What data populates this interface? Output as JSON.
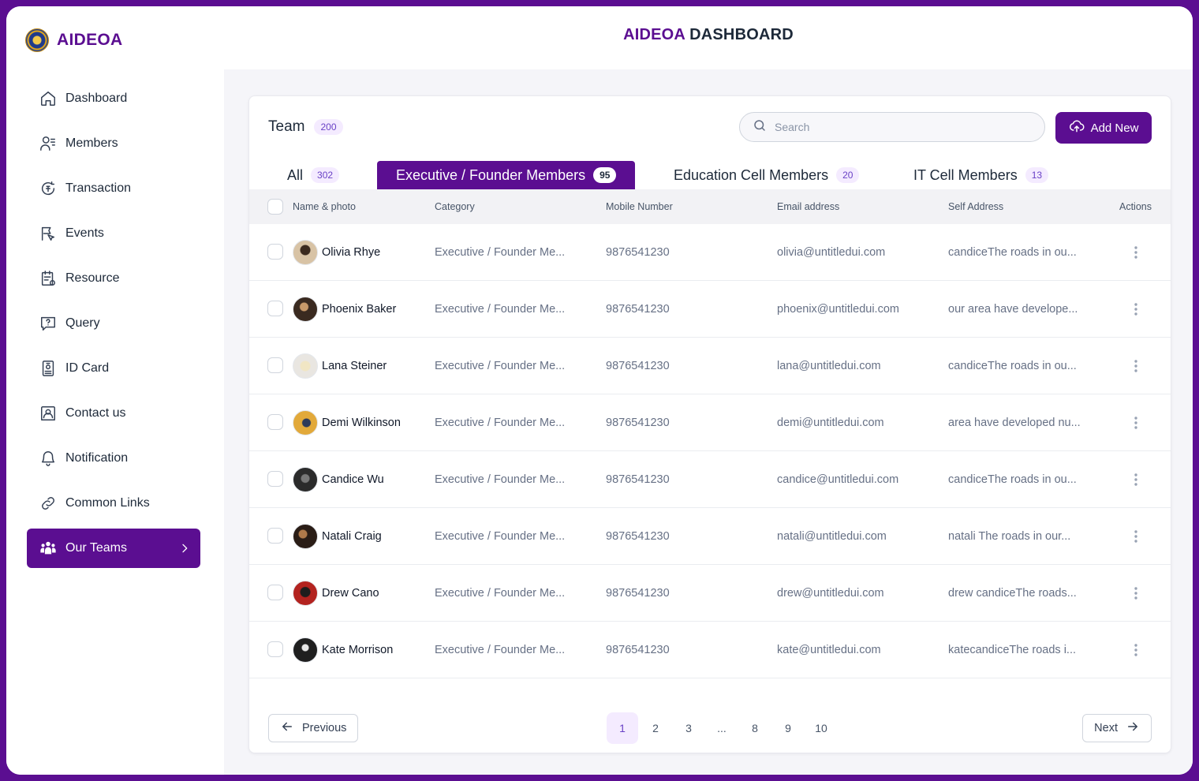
{
  "brand": {
    "name": "AIDEOA"
  },
  "header": {
    "title_accent": "AIDEOA",
    "title_rest": " DASHBOARD"
  },
  "sidebar": {
    "items": [
      {
        "label": "Dashboard",
        "icon": "home-icon"
      },
      {
        "label": "Members",
        "icon": "members-icon"
      },
      {
        "label": "Transaction",
        "icon": "transaction-icon"
      },
      {
        "label": "Events",
        "icon": "events-icon"
      },
      {
        "label": "Resource",
        "icon": "resource-icon"
      },
      {
        "label": "Query",
        "icon": "query-icon"
      },
      {
        "label": "ID Card",
        "icon": "id-card-icon"
      },
      {
        "label": "Contact us",
        "icon": "contact-icon"
      },
      {
        "label": "Notification",
        "icon": "bell-icon"
      },
      {
        "label": "Common Links",
        "icon": "link-icon"
      },
      {
        "label": "Our Teams",
        "icon": "teams-icon",
        "active": true
      }
    ]
  },
  "team": {
    "title": "Team",
    "count": "200",
    "search_placeholder": "Search",
    "add_label": "Add New"
  },
  "tabs": [
    {
      "label": "All",
      "count": "302"
    },
    {
      "label": "Executive / Founder Members",
      "count": "95",
      "active": true
    },
    {
      "label": "Education Cell Members",
      "count": "20"
    },
    {
      "label": "IT Cell Members",
      "count": "13"
    }
  ],
  "columns": {
    "name": "Name & photo",
    "category": "Category",
    "mobile": "Mobile Number",
    "email": "Email address",
    "address": "Self Address",
    "actions": "Actions"
  },
  "rows": [
    {
      "name": "Olivia Rhye",
      "category": "Executive / Founder Me...",
      "mobile": "9876541230",
      "email": "olivia@untitledui.com",
      "address": "candiceThe roads in ou..."
    },
    {
      "name": "Phoenix Baker",
      "category": "Executive / Founder Me...",
      "mobile": "9876541230",
      "email": "phoenix@untitledui.com",
      "address": "our area have develope..."
    },
    {
      "name": "Lana Steiner",
      "category": "Executive / Founder Me...",
      "mobile": "9876541230",
      "email": "lana@untitledui.com",
      "address": "candiceThe roads in ou..."
    },
    {
      "name": "Demi Wilkinson",
      "category": "Executive / Founder Me...",
      "mobile": "9876541230",
      "email": "demi@untitledui.com",
      "address": "area have developed nu..."
    },
    {
      "name": "Candice Wu",
      "category": "Executive / Founder Me...",
      "mobile": "9876541230",
      "email": "candice@untitledui.com",
      "address": "candiceThe roads in ou..."
    },
    {
      "name": "Natali Craig",
      "category": "Executive / Founder Me...",
      "mobile": "9876541230",
      "email": "natali@untitledui.com",
      "address": "natali The roads in our..."
    },
    {
      "name": "Drew Cano",
      "category": "Executive / Founder Me...",
      "mobile": "9876541230",
      "email": "drew@untitledui.com",
      "address": "drew candiceThe roads..."
    },
    {
      "name": "Kate Morrison",
      "category": "Executive / Founder Me...",
      "mobile": "9876541230",
      "email": "kate@untitledui.com",
      "address": "katecandiceThe roads i..."
    }
  ],
  "pagination": {
    "previous": "Previous",
    "next": "Next",
    "pages": [
      "1",
      "2",
      "3",
      "...",
      "8",
      "9",
      "10"
    ],
    "current": "1"
  },
  "colors": {
    "accent": "#5b0e91",
    "badge_bg": "#f4ebff",
    "badge_text": "#6941c6"
  }
}
